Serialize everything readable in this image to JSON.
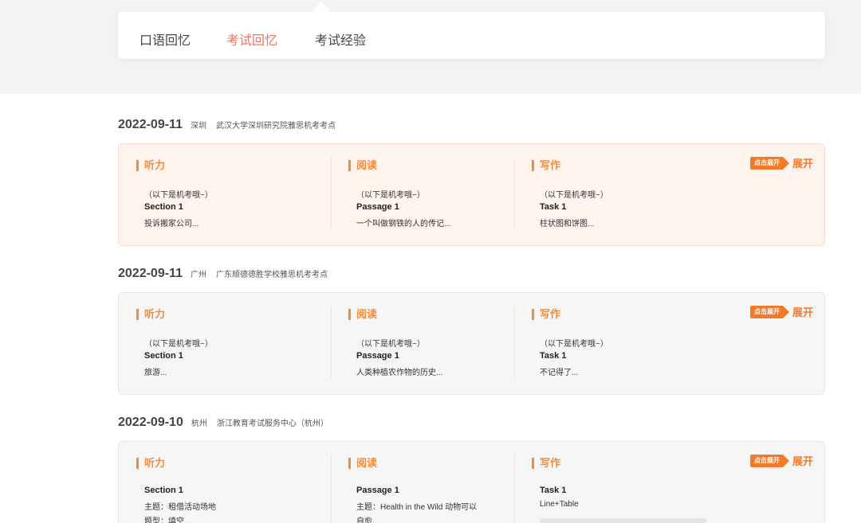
{
  "tabs": [
    {
      "label": "口语回忆",
      "active": false
    },
    {
      "label": "考试回忆",
      "active": true
    },
    {
      "label": "考试经验",
      "active": false
    }
  ],
  "expand": {
    "badge": "点击展开",
    "label": "展开"
  },
  "exams": [
    {
      "date": "2022-09-11",
      "city": "深圳",
      "venue": "武汉大学深圳研究院雅思机考考点",
      "sections": [
        {
          "title": "听力",
          "lines": [
            "（以下是机考哦~）",
            "Section 1",
            "投诉搬家公司..."
          ]
        },
        {
          "title": "阅读",
          "lines": [
            "（以下是机考哦~）",
            "Passage 1",
            "一个叫做钢铁的人的传记..."
          ]
        },
        {
          "title": "写作",
          "lines": [
            "（以下是机考哦~）",
            "Task 1",
            "柱状图和饼图..."
          ]
        }
      ]
    },
    {
      "date": "2022-09-11",
      "city": "广州",
      "venue": "广东顺德德胜学校雅思机考考点",
      "sections": [
        {
          "title": "听力",
          "lines": [
            "（以下是机考哦~）",
            "Section 1",
            "旅游..."
          ]
        },
        {
          "title": "阅读",
          "lines": [
            "（以下是机考哦~）",
            "Passage 1",
            "人类种植农作物的历史..."
          ]
        },
        {
          "title": "写作",
          "lines": [
            "（以下是机考哦~）",
            "Task 1",
            "不记得了..."
          ]
        }
      ]
    },
    {
      "date": "2022-09-10",
      "city": "杭州",
      "venue": "浙江教育考试服务中心（杭州）",
      "sections": [
        {
          "title": "听力",
          "lines": [
            "Section 1",
            "主题：租借活动场地",
            "题型：填空..."
          ]
        },
        {
          "title": "阅读",
          "lines": [
            "Passage 1",
            "主题：Health in the Wild 动物可以",
            "自愈..."
          ]
        },
        {
          "title": "写作",
          "lines": [
            "Task 1",
            "Line+Table"
          ]
        }
      ]
    }
  ],
  "colors": {
    "accent": "#f0715e",
    "orange": "#f47a2b",
    "highlight_bg": "#fff3ed"
  }
}
